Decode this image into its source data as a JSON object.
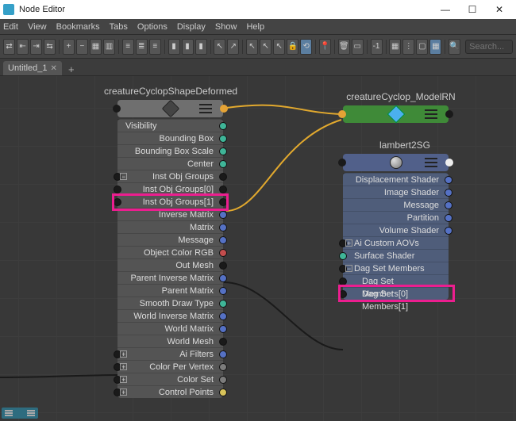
{
  "window": {
    "title": "Node Editor"
  },
  "menu": {
    "items": [
      "Edit",
      "View",
      "Bookmarks",
      "Tabs",
      "Options",
      "Display",
      "Show",
      "Help"
    ]
  },
  "tabs": {
    "active": "Untitled_1"
  },
  "search": {
    "placeholder": "Search..."
  },
  "nodes": {
    "deformed": {
      "title": "creatureCyclopShapeDeformed",
      "attrs": [
        "Visibility",
        "Bounding Box",
        "Bounding Box Scale",
        "Center",
        "Inst Obj Groups",
        "Inst Obj Groups[0]",
        "Inst Obj Groups[1]",
        "Inverse Matrix",
        "Matrix",
        "Message",
        "Object Color RGB",
        "Out Mesh",
        "Parent Inverse Matrix",
        "Parent Matrix",
        "Smooth Draw Type",
        "World Inverse Matrix",
        "World Matrix",
        "World Mesh",
        "Ai Filters",
        "Color Per Vertex",
        "Color Set",
        "Control Points"
      ]
    },
    "modelRN": {
      "title": "creatureCyclop_ModelRN"
    },
    "lambert": {
      "title": "lambert2SG",
      "attrs_right": [
        "Displacement Shader",
        "Image Shader",
        "Message",
        "Partition",
        "Volume Shader"
      ],
      "attrs_left": [
        "Ai Custom AOVs",
        "Surface Shader",
        "Dag Set Members",
        "Dag Set Members[0]",
        "Dag Set Members[1]"
      ]
    }
  },
  "toolbar_value": "-1"
}
